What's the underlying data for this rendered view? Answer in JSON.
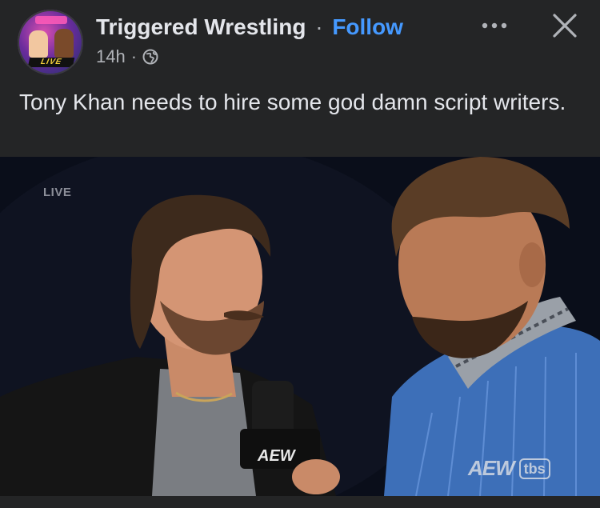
{
  "post": {
    "page_name": "Triggered Wrestling",
    "separator": "·",
    "follow_label": "Follow",
    "timestamp": "14h",
    "meta_separator": "·",
    "audience_icon": "globe-icon",
    "more_icon": "more-horizontal-icon",
    "close_icon": "close-icon",
    "avatar_badge": "LIVE",
    "caption": "Tony Khan needs to hire some god damn script writers."
  },
  "media": {
    "live_label": "LIVE",
    "logo_aew": "AEW",
    "logo_tbs": "tbs",
    "mic_flag": "AEW"
  },
  "colors": {
    "background": "#242526",
    "text_primary": "#e4e6eb",
    "text_secondary": "#b0b3b8",
    "follow_accent": "#4599ff"
  }
}
